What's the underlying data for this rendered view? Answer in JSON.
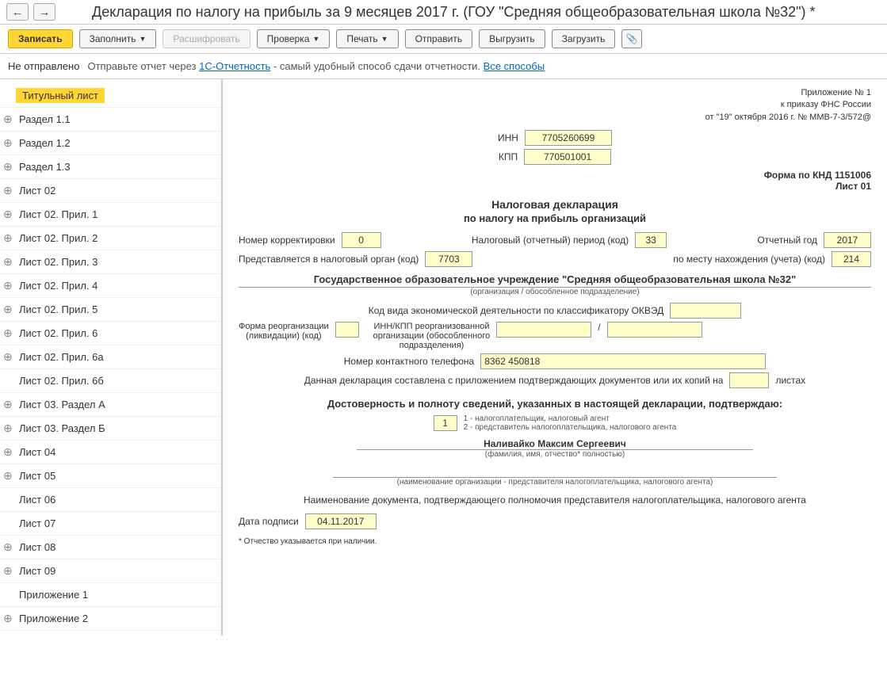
{
  "header": {
    "title": "Декларация по налогу на прибыль за 9 месяцев 2017 г. (ГОУ \"Средняя общеобразовательная школа №32\") *"
  },
  "toolbar": {
    "save": "Записать",
    "fill": "Заполнить",
    "decode": "Расшифровать",
    "check": "Проверка",
    "print": "Печать",
    "send": "Отправить",
    "export": "Выгрузить",
    "import": "Загрузить"
  },
  "status": {
    "label": "Не отправлено",
    "hint_prefix": "Отправьте отчет через ",
    "hint_link1": "1С-Отчетность",
    "hint_mid": " - самый удобный способ сдачи отчетности. ",
    "hint_link2": "Все способы"
  },
  "sidebar": {
    "items": [
      {
        "label": "Титульный лист",
        "active": true,
        "expandable": false
      },
      {
        "label": "Раздел 1.1",
        "expandable": true
      },
      {
        "label": "Раздел 1.2",
        "expandable": true
      },
      {
        "label": "Раздел 1.3",
        "expandable": true
      },
      {
        "label": "Лист 02",
        "expandable": true
      },
      {
        "label": "Лист 02. Прил. 1",
        "expandable": true
      },
      {
        "label": "Лист 02. Прил. 2",
        "expandable": true
      },
      {
        "label": "Лист 02. Прил. 3",
        "expandable": true
      },
      {
        "label": "Лист 02. Прил. 4",
        "expandable": true
      },
      {
        "label": "Лист 02. Прил. 5",
        "expandable": true
      },
      {
        "label": "Лист 02. Прил. 6",
        "expandable": true
      },
      {
        "label": "Лист 02. Прил. 6а",
        "expandable": true
      },
      {
        "label": "Лист 02. Прил. 6б",
        "expandable": false
      },
      {
        "label": "Лист 03. Раздел А",
        "expandable": true
      },
      {
        "label": "Лист 03. Раздел Б",
        "expandable": true
      },
      {
        "label": "Лист 04",
        "expandable": true
      },
      {
        "label": "Лист 05",
        "expandable": true
      },
      {
        "label": "Лист 06",
        "expandable": false
      },
      {
        "label": "Лист 07",
        "expandable": false
      },
      {
        "label": "Лист 08",
        "expandable": true
      },
      {
        "label": "Лист 09",
        "expandable": true
      },
      {
        "label": "Приложение 1",
        "expandable": false
      },
      {
        "label": "Приложение 2",
        "expandable": true
      }
    ]
  },
  "form": {
    "meta1": "Приложение № 1",
    "meta2": "к приказу ФНС России",
    "meta3": "от \"19\" октября 2016 г. № ММВ-7-3/572@",
    "inn_label": "ИНН",
    "inn_value": "7705260699",
    "kpp_label": "КПП",
    "kpp_value": "770501001",
    "knd": "Форма по КНД 1151006",
    "list": "Лист 01",
    "title": "Налоговая декларация",
    "subtitle": "по налогу на прибыль организаций",
    "corr_label": "Номер корректировки",
    "corr_value": "0",
    "period_label": "Налоговый (отчетный) период (код)",
    "period_value": "33",
    "year_label": "Отчетный год",
    "year_value": "2017",
    "authority_label": "Представляется в налоговый орган (код)",
    "authority_value": "7703",
    "location_label": "по месту нахождения (учета) (код)",
    "location_value": "214",
    "org_name": "Государственное образовательное учреждение \"Средняя общеобразовательная школа №32\"",
    "org_note": "(организация / обособленное подразделение)",
    "okved_label": "Код вида экономической деятельности по классификатору ОКВЭД",
    "okved_value": "",
    "reorg_form_label1": "Форма реорганизации",
    "reorg_form_label2": "(ликвидации) (код)",
    "reorg_form_value": "",
    "reorg_inn_label1": "ИНН/КПП реорганизованной",
    "reorg_inn_label2": "организации (обособленного",
    "reorg_inn_label3": "подразделения)",
    "reorg_inn_value1": "",
    "reorg_inn_value2": "",
    "phone_label": "Номер контактного телефона",
    "phone_value": "8362 450818",
    "docs_label1": "Данная декларация составлена с приложением подтверждающих документов или их копий на",
    "docs_value": "",
    "docs_label2": "листах",
    "confirm_title": "Достоверность и полноту сведений, указанных в настоящей декларации, подтверждаю:",
    "signer_code": "1",
    "signer_note1": "1 - налогоплательщик, налоговый агент",
    "signer_note2": "2 - представитель налогоплательщика, налогового агента",
    "signer_name": "Наливайко Максим Сергеевич",
    "signer_name_note": "(фамилия, имя, отчество* полностью)",
    "rep_org_note": "(наименование организации - представителя налогоплательщика, налогового агента)",
    "rep_doc_label": "Наименование документа, подтверждающего полномочия представителя налогоплательщика, налогового агента",
    "sign_date_label": "Дата подписи",
    "sign_date_value": "04.11.2017",
    "footnote": "* Отчество указывается при наличии."
  }
}
